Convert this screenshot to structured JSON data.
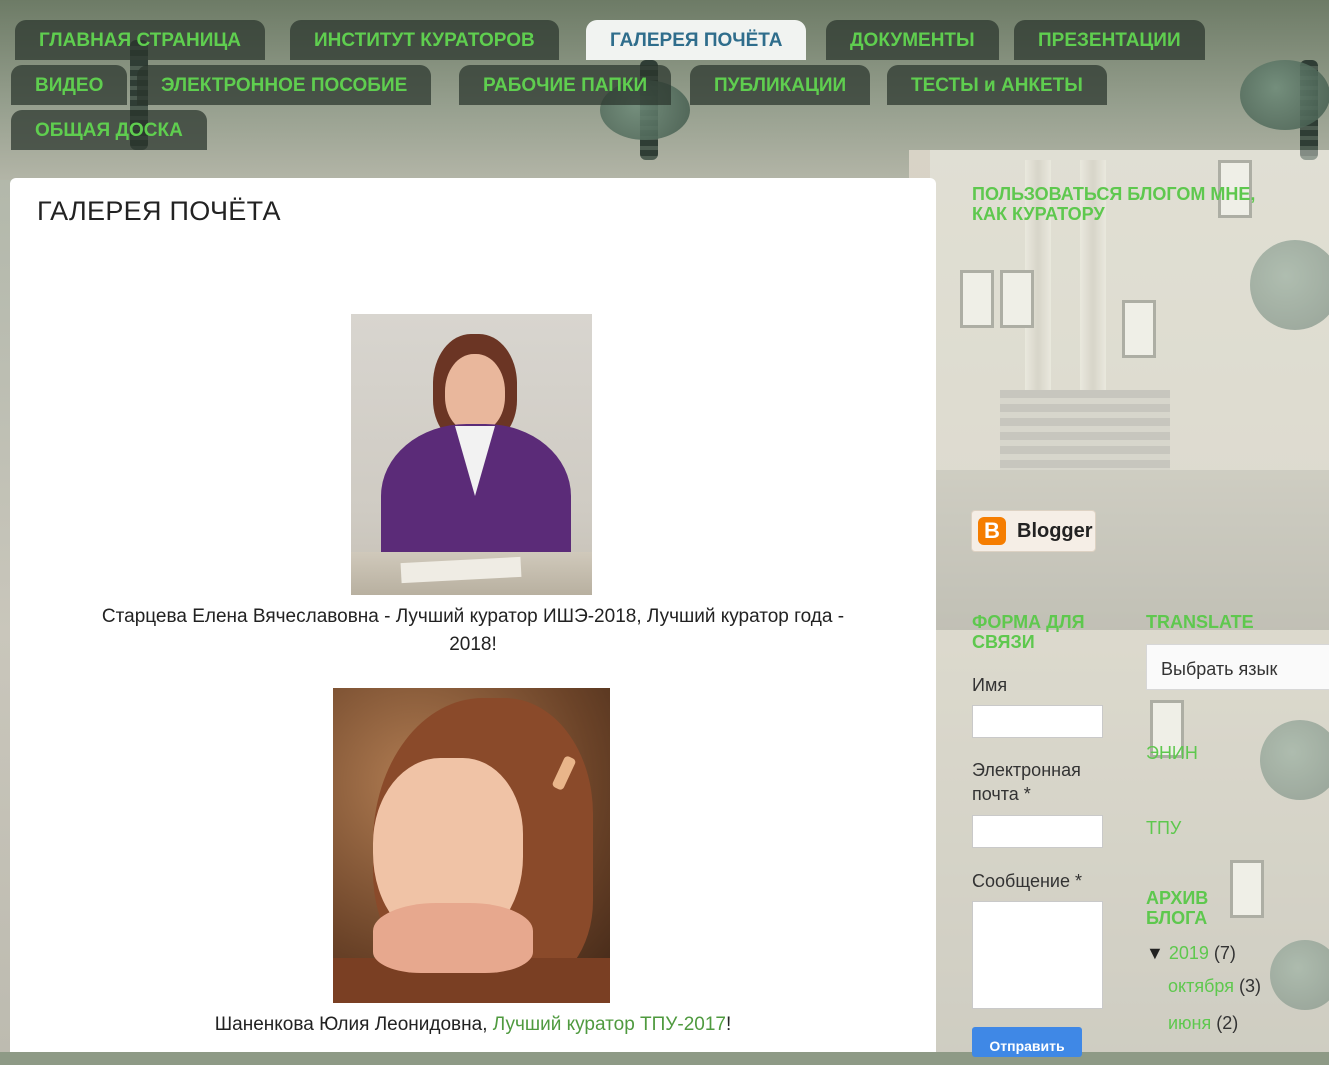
{
  "nav": {
    "tabs": [
      {
        "label": "ГЛАВНАЯ СТРАНИЦА",
        "active": false
      },
      {
        "label": "ИНСТИТУТ КУРАТОРОВ",
        "active": false
      },
      {
        "label": "ГАЛЕРЕЯ ПОЧЁТА",
        "active": true
      },
      {
        "label": "ДОКУМЕНТЫ",
        "active": false
      },
      {
        "label": "ПРЕЗЕНТАЦИИ",
        "active": false
      },
      {
        "label": "ВИДЕО",
        "active": false
      },
      {
        "label": "ЭЛЕКТРОННОЕ ПОСОБИЕ",
        "active": false
      },
      {
        "label": "РАБОЧИЕ ПАПКИ",
        "active": false
      },
      {
        "label": "ПУБЛИКАЦИИ",
        "active": false
      },
      {
        "label": "ТЕСТЫ и АНКЕТЫ",
        "active": false
      },
      {
        "label": "ОБЩАЯ ДОСКА",
        "active": false
      }
    ]
  },
  "main": {
    "title": "ГАЛЕРЕЯ ПОЧЁТА",
    "entries": [
      {
        "caption_line1": "Старцева Елена Вячеславовна - Лучший куратор ИШЭ-2018, Лучший куратор года -",
        "caption_line2": "2018!"
      },
      {
        "caption_name": "Шаненкова Юлия Леонидовна, ",
        "caption_link": "Лучший куратор ТПУ-2017",
        "caption_end": "!"
      }
    ]
  },
  "sidebar": {
    "use_blog_heading": "ПОЛЬЗОВАТЬСЯ БЛОГОМ МНЕ, КАК КУРАТОРУ",
    "blogger_badge": "Blogger",
    "contact_form": {
      "heading": "ФОРМА ДЛЯ СВЯЗИ",
      "name_label": "Имя",
      "email_label": "Электронная почта *",
      "message_label": "Сообщение *",
      "submit_label": "Отправить"
    },
    "translate": {
      "heading": "TRANSLATE",
      "select_value": "Выбрать язык"
    },
    "links": [
      "ЭНИН",
      "ТПУ"
    ],
    "archive": {
      "heading": "АРХИВ БЛОГА",
      "year_toggle": "▼",
      "year": "2019",
      "year_count": "(7)",
      "months": [
        {
          "label": "октября",
          "count": "(3)"
        },
        {
          "label": "июня",
          "count": "(2)"
        }
      ]
    }
  },
  "colors": {
    "link_green": "#5ec84e",
    "active_tab_text": "#2f6d8c",
    "tab_bg": "rgba(42,52,44,.72)"
  }
}
